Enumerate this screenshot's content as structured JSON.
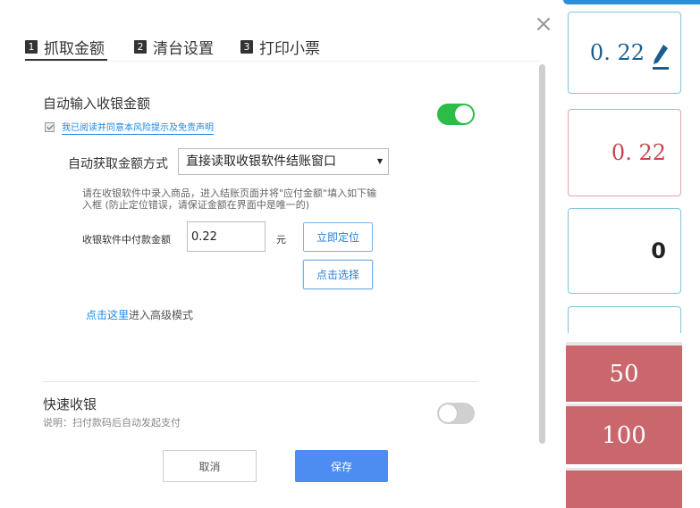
{
  "dialog": {
    "close_symbol": "×",
    "tabs": [
      {
        "num": "1",
        "label": "抓取金额"
      },
      {
        "num": "2",
        "label": "清台设置"
      },
      {
        "num": "3",
        "label": "打印小票"
      }
    ],
    "auto_input": {
      "title": "自动输入收银金额",
      "agree_text": "我已阅读并同意本风险提示及免责声明",
      "agree_checked": true,
      "toggle_on": true,
      "mode_label": "自动获取金额方式",
      "mode_value": "直接读取收银软件结账窗口",
      "hint": "请在收银软件中录入商品，进入结账页面并将\"应付金额\"填入如下输入框 (防止定位错误，请保证金额在界面中是唯一的)",
      "amount_label": "收银软件中付款金额",
      "amount_value": "0.22",
      "unit": "元",
      "locate_button": "立即定位",
      "pick_button": "点击选择",
      "advanced_link": "点击这里",
      "advanced_text": "进入高级模式"
    },
    "quick_pay": {
      "title": "快速收银",
      "description": "说明：扫付款码后自动发起支付",
      "toggle_on": false
    },
    "cancel_button": "取消",
    "save_button": "保存"
  },
  "side_panel": {
    "amount_edit": "0. 22",
    "amount_due": "0. 22",
    "amount_input": "0",
    "quick_amounts": [
      "50",
      "100"
    ]
  },
  "colors": {
    "accent": "#1e88e5",
    "save": "#4d8cf0",
    "toggle_on": "#2bbd47",
    "quick_amount_bg": "#c9676d"
  },
  "icons": {
    "close": "close-icon",
    "pencil": "pencil-icon",
    "checkbox": "checkbox-checked-icon",
    "dropdown": "caret-down-icon"
  }
}
